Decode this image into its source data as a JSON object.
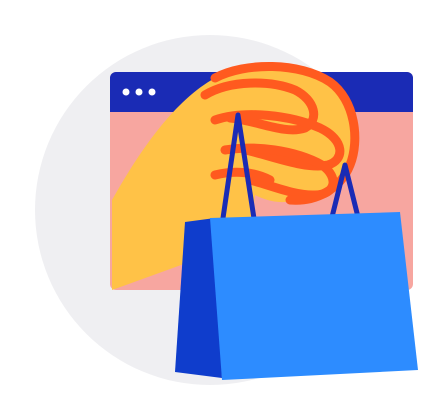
{
  "illustration": {
    "subject": "shopping-bag-in-hand-over-browser-window",
    "colors": {
      "background_circle": "#EFEFF2",
      "browser_bar": "#1A2BB5",
      "browser_dots": "#FFFFFF",
      "browser_body": "#F7A6A0",
      "hand_fill": "#FFC247",
      "hand_outline": "#FF5A1F",
      "bag_front": "#2D8CFF",
      "bag_side": "#0F3DCC",
      "bag_handles": "#1A2BB5"
    },
    "icons": [
      "browser-window-icon",
      "hand-icon",
      "shopping-bag-icon"
    ]
  }
}
